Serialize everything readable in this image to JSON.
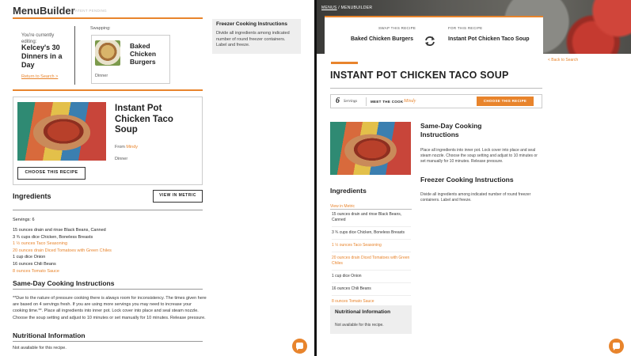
{
  "left": {
    "logo": "MenuBuilder",
    "patent": "PATENT PENDING",
    "current_label": "You're currently editing:",
    "current_name": "Kelcey's 30 Dinners in a Day",
    "return_link": "Return to Search >",
    "swapping_label": "Swapping:",
    "swap_name": "Baked Chicken Burgers",
    "swap_meal": "Dinner",
    "freezer": {
      "title": "Freezer Cooking Instructions",
      "text": "Divide all ingredients among indicated number of round freezer containers. Label and freeze."
    },
    "recipe": {
      "title": "Instant Pot Chicken Taco Soup",
      "from_label": "From",
      "author": "Mindy",
      "meal": "Dinner",
      "choose_label": "CHOOSE THIS RECIPE"
    },
    "ingredients_title": "Ingredients",
    "metric_button": "VIEW IN METRIC",
    "servings": "Servings: 6",
    "ingredients": [
      {
        "text": "15 ounces drain and rinse Black Beans, Canned",
        "accent": false
      },
      {
        "text": "3 ¾ cups dice Chicken, Boneless Breasts",
        "accent": false
      },
      {
        "text": "1 ½ ounces Taco Seasoning",
        "accent": true
      },
      {
        "text": "20 ounces drain Diced Tomatoes with Green Chiles",
        "accent": true
      },
      {
        "text": "1 cup dice Onion",
        "accent": false
      },
      {
        "text": "16 ounces Chili Beans",
        "accent": false
      },
      {
        "text": "8 ounces Tomato Sauce",
        "accent": true
      }
    ],
    "sameday_title": "Same-Day Cooking Instructions",
    "sameday_text": "**Due to the nature of pressure cooking there is always room for inconsistency. The times given here are based on 4 servings fresh. If you are using more servings you may need to increase your cooking time.**. Place all ingredients into inner pot. Lock cover into place and seal steam nozzle. Choose the soup setting and adjust to 10 minutes or set manually for 10 minutes. Release pressure.",
    "nutrition_title": "Nutritional Information",
    "nutrition_text": "Not available for this recipe."
  },
  "right": {
    "breadcrumb_link": "MENUS",
    "breadcrumb_rest": " / MENUBUILDER",
    "swap_this_label": "SWAP THIS RECIPE",
    "for_this_label": "FOR THIS RECIPE",
    "swap_from": "Baked Chicken Burgers",
    "swap_to": "Instant Pot Chicken Taco Soup",
    "back_link": "< Back to Search",
    "title": "INSTANT POT CHICKEN TACO SOUP",
    "servings_num": "6",
    "servings_label": "Servings",
    "meet_cook": "MEET THE COOK",
    "cook_name": "Mindy",
    "choose_label": "CHOOSE THIS RECIPE",
    "sameday_title": "Same-Day Cooking Instructions",
    "sameday_text": "Place all ingredients into inner pot. Lock cover into place and seal steam nozzle. Choose the soup setting and adjust to 10 minutes or set manually for 10 minutes. Release pressure.",
    "freezer_title": "Freezer Cooking Instructions",
    "freezer_text": "Divide all ingredients among indicated number of round freezer containers. Label and freeze.",
    "ingredients_title": "Ingredients",
    "view_metric": "View in Metric",
    "ingredients": [
      {
        "text": "15 ounces drain and rinse Black Beans, Canned",
        "accent": false
      },
      {
        "text": "3 ¾ cups dice Chicken, Boneless Breasts",
        "accent": false
      },
      {
        "text": "1 ½ ounces Taco Seasoning",
        "accent": true
      },
      {
        "text": "20 ounces drain Diced Tomatoes with Green Chiles",
        "accent": true
      },
      {
        "text": "1 cup dice Onion",
        "accent": false
      },
      {
        "text": "16 ounces Chili Beans",
        "accent": false
      },
      {
        "text": "8 ounces Tomato Sauce",
        "accent": true
      }
    ],
    "nutrition_title": "Nutritional Information",
    "nutrition_text": "Not available for this recipe."
  },
  "icons": {
    "chat": "chat-icon",
    "swap": "swap-arrows-icon"
  },
  "colors": {
    "accent": "#e8842c",
    "panel_gray": "#eeeeee"
  }
}
